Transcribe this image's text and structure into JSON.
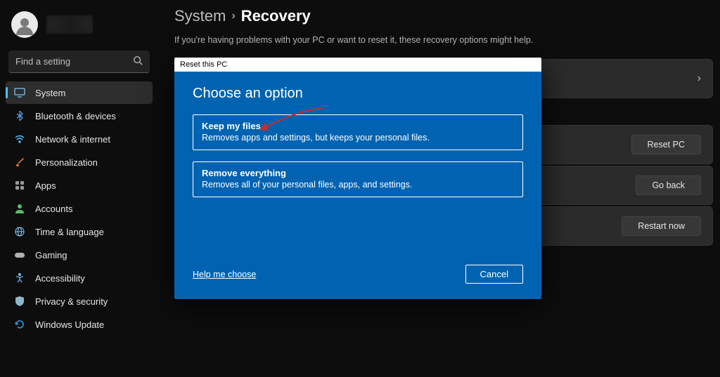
{
  "user": {
    "name_hidden": true
  },
  "search": {
    "placeholder": "Find a setting"
  },
  "sidebar": {
    "items": [
      {
        "label": "System",
        "icon": "system",
        "active": true
      },
      {
        "label": "Bluetooth & devices",
        "icon": "bluetooth"
      },
      {
        "label": "Network & internet",
        "icon": "wifi"
      },
      {
        "label": "Personalization",
        "icon": "brush"
      },
      {
        "label": "Apps",
        "icon": "apps"
      },
      {
        "label": "Accounts",
        "icon": "person"
      },
      {
        "label": "Time & language",
        "icon": "globe"
      },
      {
        "label": "Gaming",
        "icon": "gamepad"
      },
      {
        "label": "Accessibility",
        "icon": "accessibility"
      },
      {
        "label": "Privacy & security",
        "icon": "shield"
      },
      {
        "label": "Windows Update",
        "icon": "update"
      }
    ]
  },
  "breadcrumb": {
    "parent": "System",
    "current": "Recovery"
  },
  "subtitle": "If you're having problems with your PC or want to reset it, these recovery options might help.",
  "cards": [
    {
      "button": ""
    },
    {
      "button": "Reset PC"
    },
    {
      "button": "Go back"
    },
    {
      "button": "Restart now"
    }
  ],
  "dialog": {
    "titlebar": "Reset this PC",
    "heading": "Choose an option",
    "options": [
      {
        "title": "Keep my files",
        "desc": "Removes apps and settings, but keeps your personal files."
      },
      {
        "title": "Remove everything",
        "desc": "Removes all of your personal files, apps, and settings."
      }
    ],
    "help": "Help me choose",
    "cancel": "Cancel"
  },
  "icon_colors": {
    "system": "#77c6f5",
    "bluetooth": "#5aa4f0",
    "wifi": "#4cc2ff",
    "brush": "#e88a4a",
    "apps": "#9a9a9a",
    "person": "#5bbd6b",
    "globe": "#7db6e0",
    "gamepad": "#b0b0b0",
    "accessibility": "#6fb8e0",
    "shield": "#8fb7c8",
    "update": "#2c9cde"
  },
  "arrow_color": "#cc2a2a"
}
